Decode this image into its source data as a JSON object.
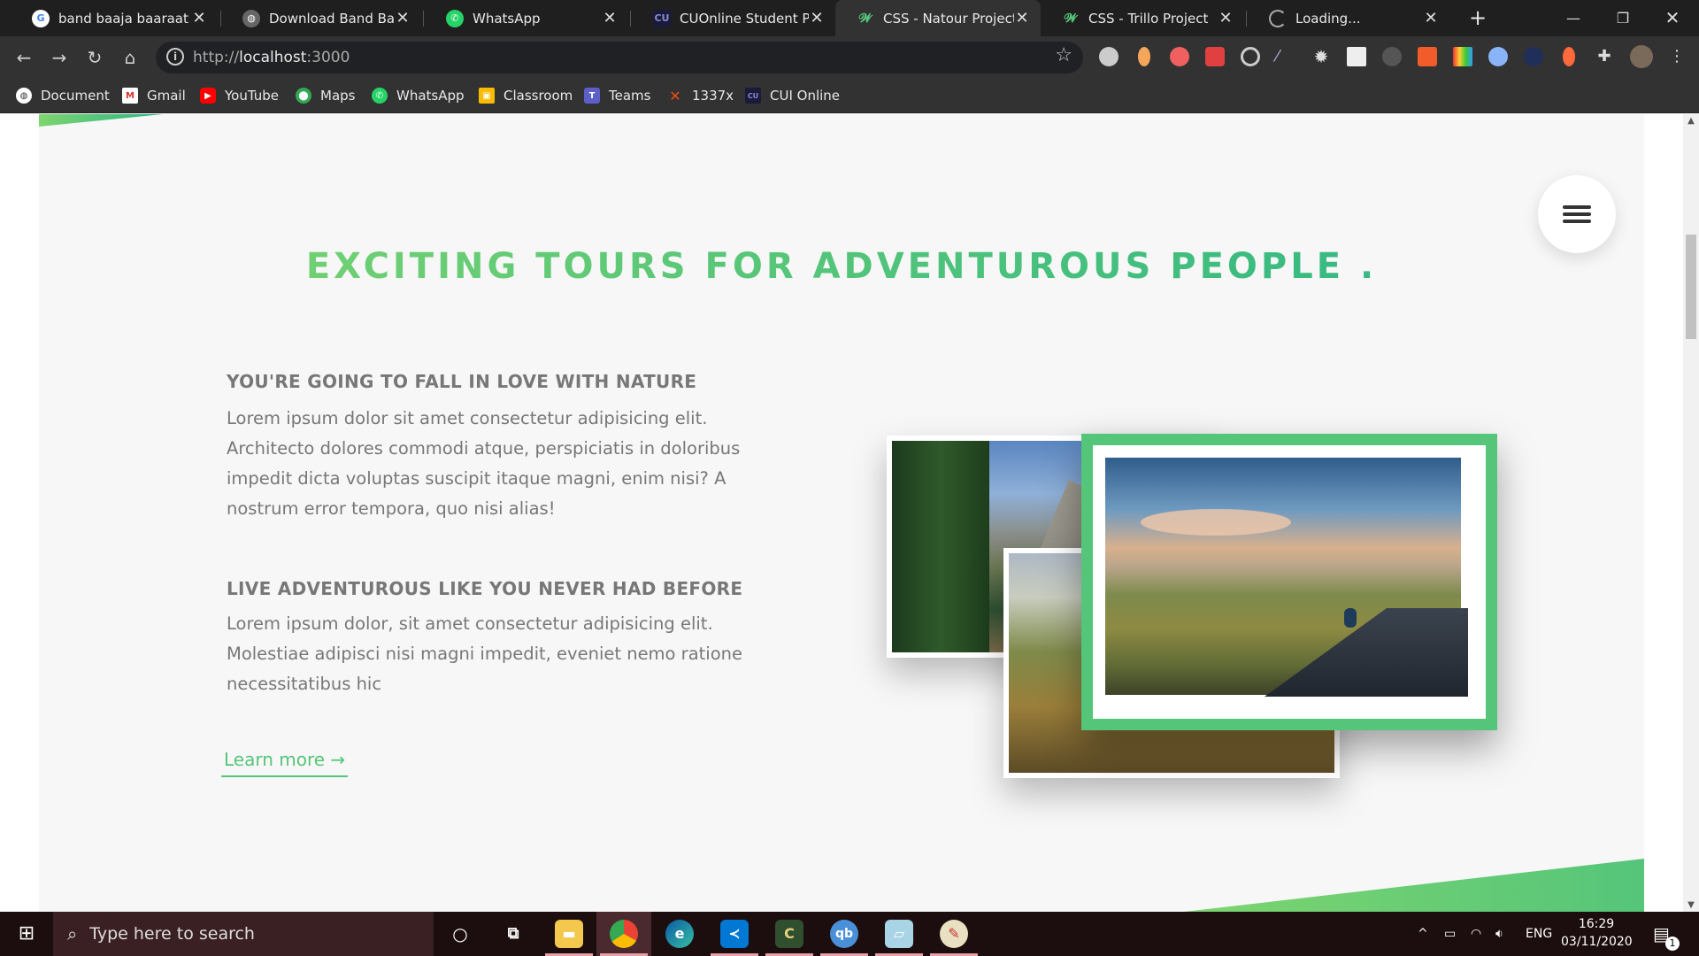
{
  "browser": {
    "tabs": [
      {
        "title": "band baaja baaraat - G",
        "active": false
      },
      {
        "title": "Download Band Baaja I",
        "active": false
      },
      {
        "title": "WhatsApp",
        "active": false
      },
      {
        "title": "CUOnline Student Port",
        "active": false
      },
      {
        "title": "CSS - Natour Project",
        "active": true
      },
      {
        "title": "CSS - Trillo Project",
        "active": false
      },
      {
        "title": "Loading...",
        "active": false
      }
    ],
    "url_scheme": "http://",
    "url_host": "localhost",
    "url_port": ":3000",
    "bookmarks": [
      {
        "label": "Document",
        "icon": "globe-icon"
      },
      {
        "label": "Gmail",
        "icon": "gmail-icon"
      },
      {
        "label": "YouTube",
        "icon": "youtube-icon"
      },
      {
        "label": "Maps",
        "icon": "maps-icon"
      },
      {
        "label": "WhatsApp",
        "icon": "whatsapp-icon"
      },
      {
        "label": "Classroom",
        "icon": "classroom-icon"
      },
      {
        "label": "Teams",
        "icon": "teams-icon"
      },
      {
        "label": "1337x",
        "icon": "x-icon"
      },
      {
        "label": "CUI Online",
        "icon": "cui-icon"
      }
    ]
  },
  "page": {
    "heading": "EXCITING TOURS FOR ADVENTUROUS PEOPLE .",
    "features": [
      {
        "title": "YOU'RE GOING TO FALL IN LOVE WITH NATURE",
        "lines": [
          "Lorem ipsum dolor sit amet consectetur adipisicing elit.",
          "Architecto dolores commodi atque, perspiciatis in doloribus",
          "impedit dicta voluptas suscipit itaque magni, enim nisi? A",
          "nostrum error tempora, quo nisi alias!"
        ]
      },
      {
        "title": "LIVE ADVENTUROUS LIKE YOU NEVER HAD BEFORE",
        "lines": [
          "Lorem ipsum dolor, sit amet consectetur adipisicing elit.",
          "Molestiae adipisci nisi magni impedit, eveniet nemo ratione",
          "necessitatibus hic"
        ]
      }
    ],
    "learn_more": "Learn more →",
    "accent": "#55c57a",
    "gradient_light": "#7ed56f",
    "gradient_dark": "#28b485"
  },
  "taskbar": {
    "search_placeholder": "Type here to search",
    "language": "ENG",
    "time": "16:29",
    "date": "03/11/2020",
    "notification_count": "1"
  }
}
